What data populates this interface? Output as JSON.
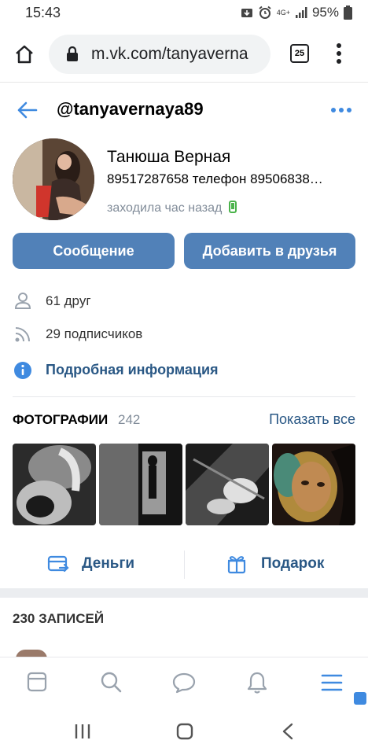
{
  "status_bar": {
    "time": "15:43",
    "network": "4G+",
    "battery": "95%"
  },
  "browser": {
    "url": "m.vk.com/tanyaverna",
    "tab_count": "25"
  },
  "profile": {
    "username": "@tanyavernaya89",
    "name": "Танюша Верная",
    "status": "89517287658 телефон 89506838…",
    "last_seen": "заходила час назад",
    "message_button": "Сообщение",
    "add_friend_button": "Добавить в друзья",
    "friends": "61 друг",
    "followers": "29 подписчиков",
    "details_link": "Подробная информация"
  },
  "photos": {
    "title": "ФОТОГРАФИИ",
    "count": "242",
    "show_all": "Показать все"
  },
  "actions": {
    "money": "Деньги",
    "gift": "Подарок"
  },
  "posts": {
    "title": "230 ЗАПИСЕЙ"
  },
  "colors": {
    "accent": "#5181b8",
    "link": "#2a5885",
    "online": "#4bb34b"
  }
}
